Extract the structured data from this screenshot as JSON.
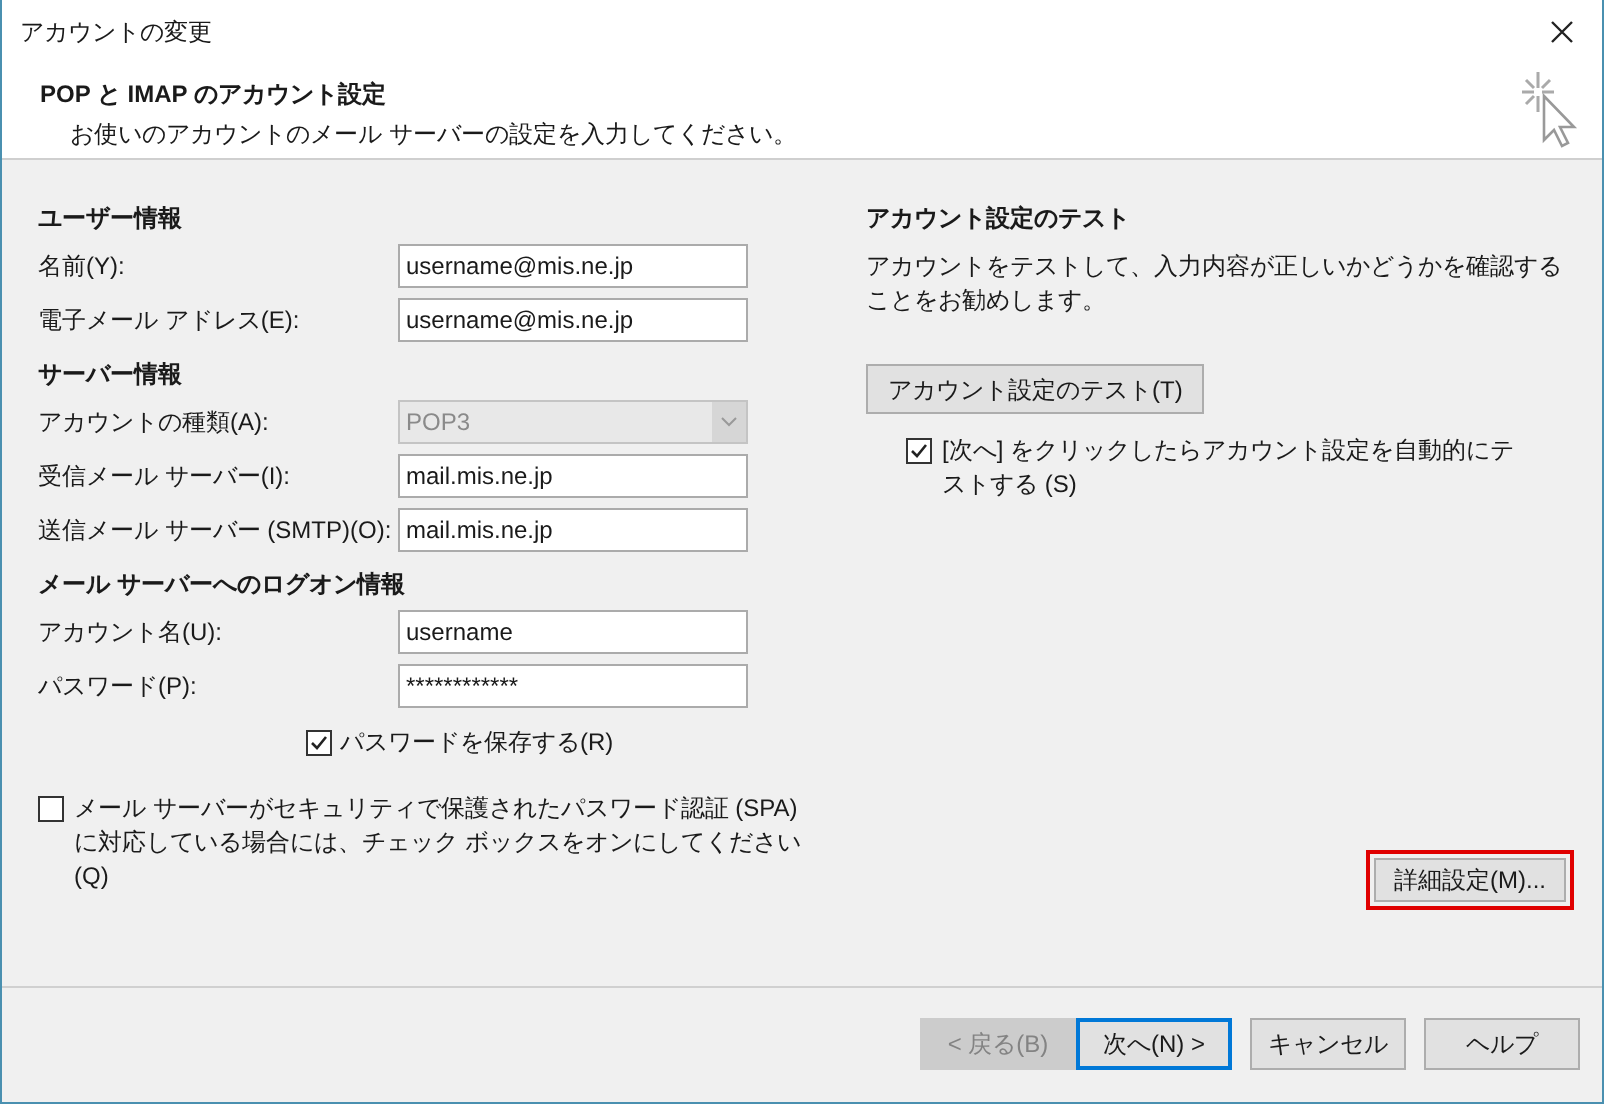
{
  "window": {
    "title": "アカウントの変更"
  },
  "header": {
    "title": "POP と IMAP のアカウント設定",
    "subtitle": "お使いのアカウントのメール サーバーの設定を入力してください。"
  },
  "left_sections": [
    {
      "title": "ユーザー情報",
      "fields": [
        {
          "kind": "text",
          "label": "名前(Y):",
          "value": "username@mis.ne.jp"
        },
        {
          "kind": "text",
          "label": "電子メール アドレス(E):",
          "value": "username@mis.ne.jp"
        }
      ]
    },
    {
      "title": "サーバー情報",
      "fields": [
        {
          "kind": "dropdown",
          "label": "アカウントの種類(A):",
          "value": "POP3",
          "disabled": true
        },
        {
          "kind": "text",
          "label": "受信メール サーバー(I):",
          "value": "mail.mis.ne.jp"
        },
        {
          "kind": "text",
          "label": "送信メール サーバー (SMTP)(O):",
          "value": "mail.mis.ne.jp"
        }
      ]
    },
    {
      "title": "メール サーバーへのログオン情報",
      "fields": [
        {
          "kind": "text",
          "label": "アカウント名(U):",
          "value": "username"
        },
        {
          "kind": "text",
          "label": "パスワード(P):",
          "value": "************"
        }
      ]
    }
  ],
  "remember_password": {
    "label": "パスワードを保存する(R)",
    "checked": true
  },
  "spa": {
    "label": "メール サーバーがセキュリティで保護されたパスワード認証 (SPA) に対応している場合には、チェック ボックスをオンにしてください(Q)",
    "checked": false
  },
  "test_section": {
    "title": "アカウント設定のテスト",
    "description": "アカウントをテストして、入力内容が正しいかどうかを確認することをお勧めします。",
    "button": "アカウント設定のテスト(T)",
    "auto_test": {
      "label": "[次へ] をクリックしたらアカウント設定を自動的にテストする (S)",
      "checked": true
    }
  },
  "advanced_button": {
    "label": "詳細設定(M)...",
    "highlighted": true
  },
  "footer_buttons": [
    {
      "label": "< 戻る(B)",
      "disabled": true,
      "default": false
    },
    {
      "label": "次へ(N) >",
      "disabled": false,
      "default": true
    },
    {
      "label": "キャンセル",
      "disabled": false,
      "default": false
    },
    {
      "label": "ヘルプ",
      "disabled": false,
      "default": false
    }
  ]
}
